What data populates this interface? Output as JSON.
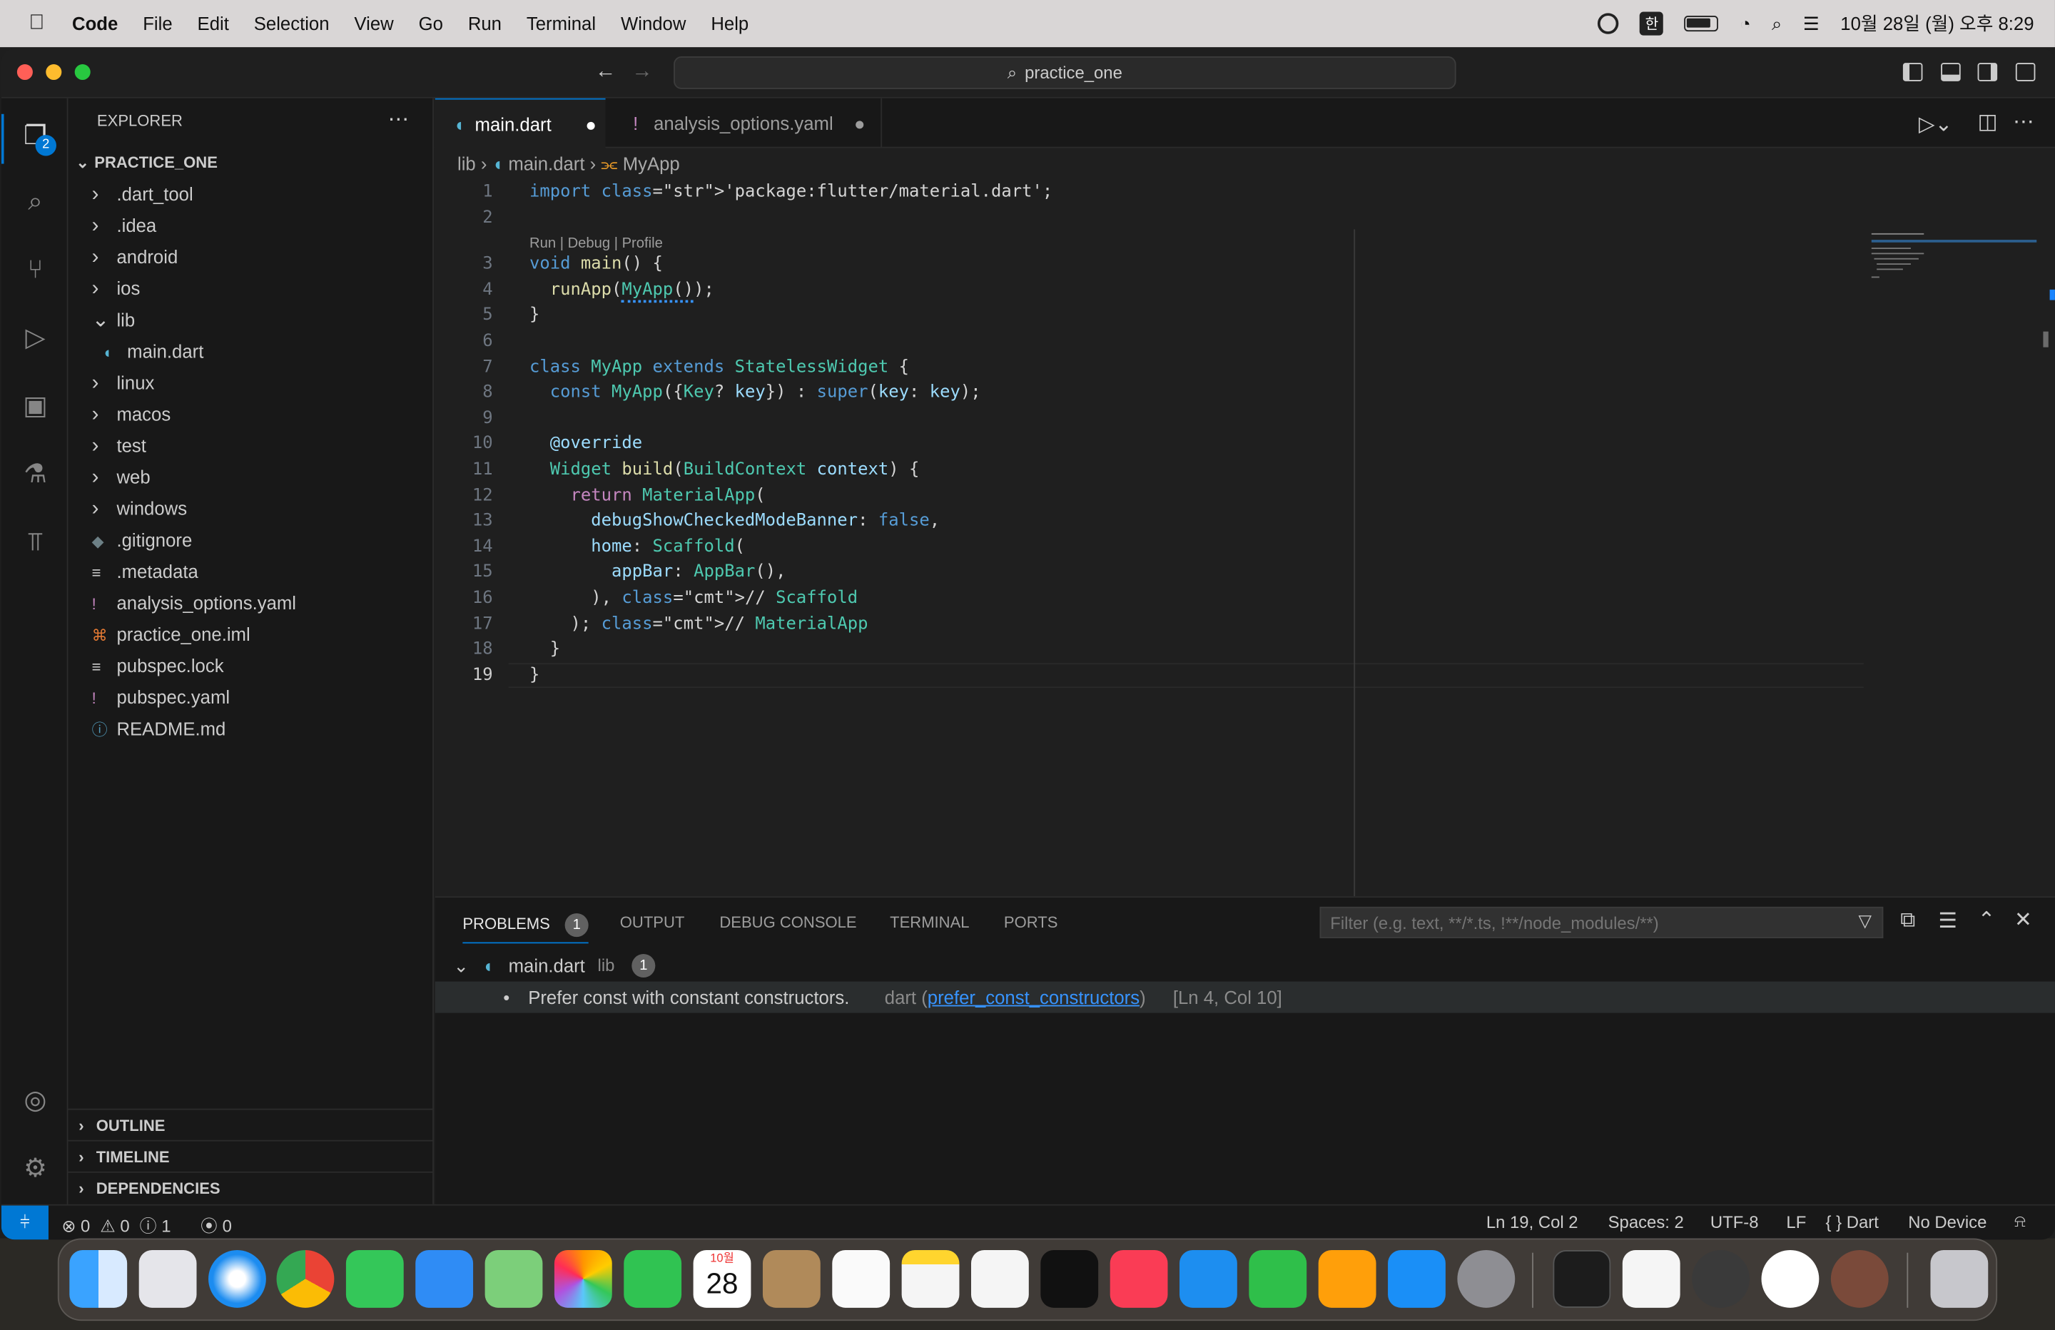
{
  "menubar": {
    "app_name": "Code",
    "items": [
      "File",
      "Edit",
      "Selection",
      "View",
      "Go",
      "Run",
      "Terminal",
      "Window",
      "Help"
    ],
    "input_lang": "한",
    "clock": "10월 28일 (월) 오후 8:29"
  },
  "titlebar": {
    "search_text": "practice_one"
  },
  "activity": {
    "explorer_badge": "2"
  },
  "sidebar": {
    "title": "EXPLORER",
    "root": "PRACTICE_ONE",
    "items": [
      {
        "label": ".dart_tool",
        "type": "folder"
      },
      {
        "label": ".idea",
        "type": "folder"
      },
      {
        "label": "android",
        "type": "folder"
      },
      {
        "label": "ios",
        "type": "folder"
      },
      {
        "label": "lib",
        "type": "folder-open"
      },
      {
        "label": "main.dart",
        "type": "file-dart"
      },
      {
        "label": "linux",
        "type": "folder"
      },
      {
        "label": "macos",
        "type": "folder"
      },
      {
        "label": "test",
        "type": "folder"
      },
      {
        "label": "web",
        "type": "folder"
      },
      {
        "label": "windows",
        "type": "folder"
      },
      {
        "label": ".gitignore",
        "type": "file-git"
      },
      {
        "label": ".metadata",
        "type": "file-text"
      },
      {
        "label": "analysis_options.yaml",
        "type": "file-yaml"
      },
      {
        "label": "practice_one.iml",
        "type": "file-rss"
      },
      {
        "label": "pubspec.lock",
        "type": "file-text"
      },
      {
        "label": "pubspec.yaml",
        "type": "file-yaml"
      },
      {
        "label": "README.md",
        "type": "file-info"
      }
    ],
    "sections": [
      "OUTLINE",
      "TIMELINE",
      "DEPENDENCIES"
    ]
  },
  "tabs": [
    {
      "label": "main.dart",
      "active": true
    },
    {
      "label": "analysis_options.yaml",
      "active": false
    }
  ],
  "breadcrumb": {
    "folder": "lib",
    "file": "main.dart",
    "symbol": "MyApp"
  },
  "codelens": "Run | Debug | Profile",
  "code_lines": [
    {
      "n": "1",
      "text": "import 'package:flutter/material.dart';"
    },
    {
      "n": "2",
      "text": ""
    },
    {
      "n": "3",
      "text": "void main() {"
    },
    {
      "n": "4",
      "text": "  runApp(MyApp());"
    },
    {
      "n": "5",
      "text": "}"
    },
    {
      "n": "6",
      "text": ""
    },
    {
      "n": "7",
      "text": "class MyApp extends StatelessWidget {"
    },
    {
      "n": "8",
      "text": "  const MyApp({Key? key}) : super(key: key);"
    },
    {
      "n": "9",
      "text": ""
    },
    {
      "n": "10",
      "text": "  @override"
    },
    {
      "n": "11",
      "text": "  Widget build(BuildContext context) {"
    },
    {
      "n": "12",
      "text": "    return MaterialApp("
    },
    {
      "n": "13",
      "text": "      debugShowCheckedModeBanner: false,"
    },
    {
      "n": "14",
      "text": "      home: Scaffold("
    },
    {
      "n": "15",
      "text": "        appBar: AppBar(),"
    },
    {
      "n": "16",
      "text": "      ), // Scaffold"
    },
    {
      "n": "17",
      "text": "    ); // MaterialApp"
    },
    {
      "n": "18",
      "text": "  }"
    },
    {
      "n": "19",
      "text": "}"
    }
  ],
  "panel": {
    "tabs": [
      "PROBLEMS",
      "OUTPUT",
      "DEBUG CONSOLE",
      "TERMINAL",
      "PORTS"
    ],
    "problems_count": "1",
    "filter_placeholder": "Filter (e.g. text, **/*.ts, !**/node_modules/**)",
    "group_file": "main.dart",
    "group_folder": "lib",
    "group_count": "1",
    "problem_message": "Prefer const with constant constructors.",
    "problem_source": "dart",
    "problem_code": "prefer_const_constructors",
    "problem_location": "[Ln 4, Col 10]"
  },
  "statusbar": {
    "errors": "0",
    "warnings": "0",
    "infos": "1",
    "ports": "0",
    "cursor": "Ln 19, Col 2",
    "spaces": "Spaces: 2",
    "encoding": "UTF-8",
    "eol": "LF",
    "language": "Dart",
    "device": "No Device"
  },
  "dock": {
    "calendar_month": "10월",
    "calendar_day": "28"
  },
  "colors": {
    "accent": "#0078d4",
    "editor_bg": "#1f1f1f",
    "sidebar_bg": "#181818"
  }
}
